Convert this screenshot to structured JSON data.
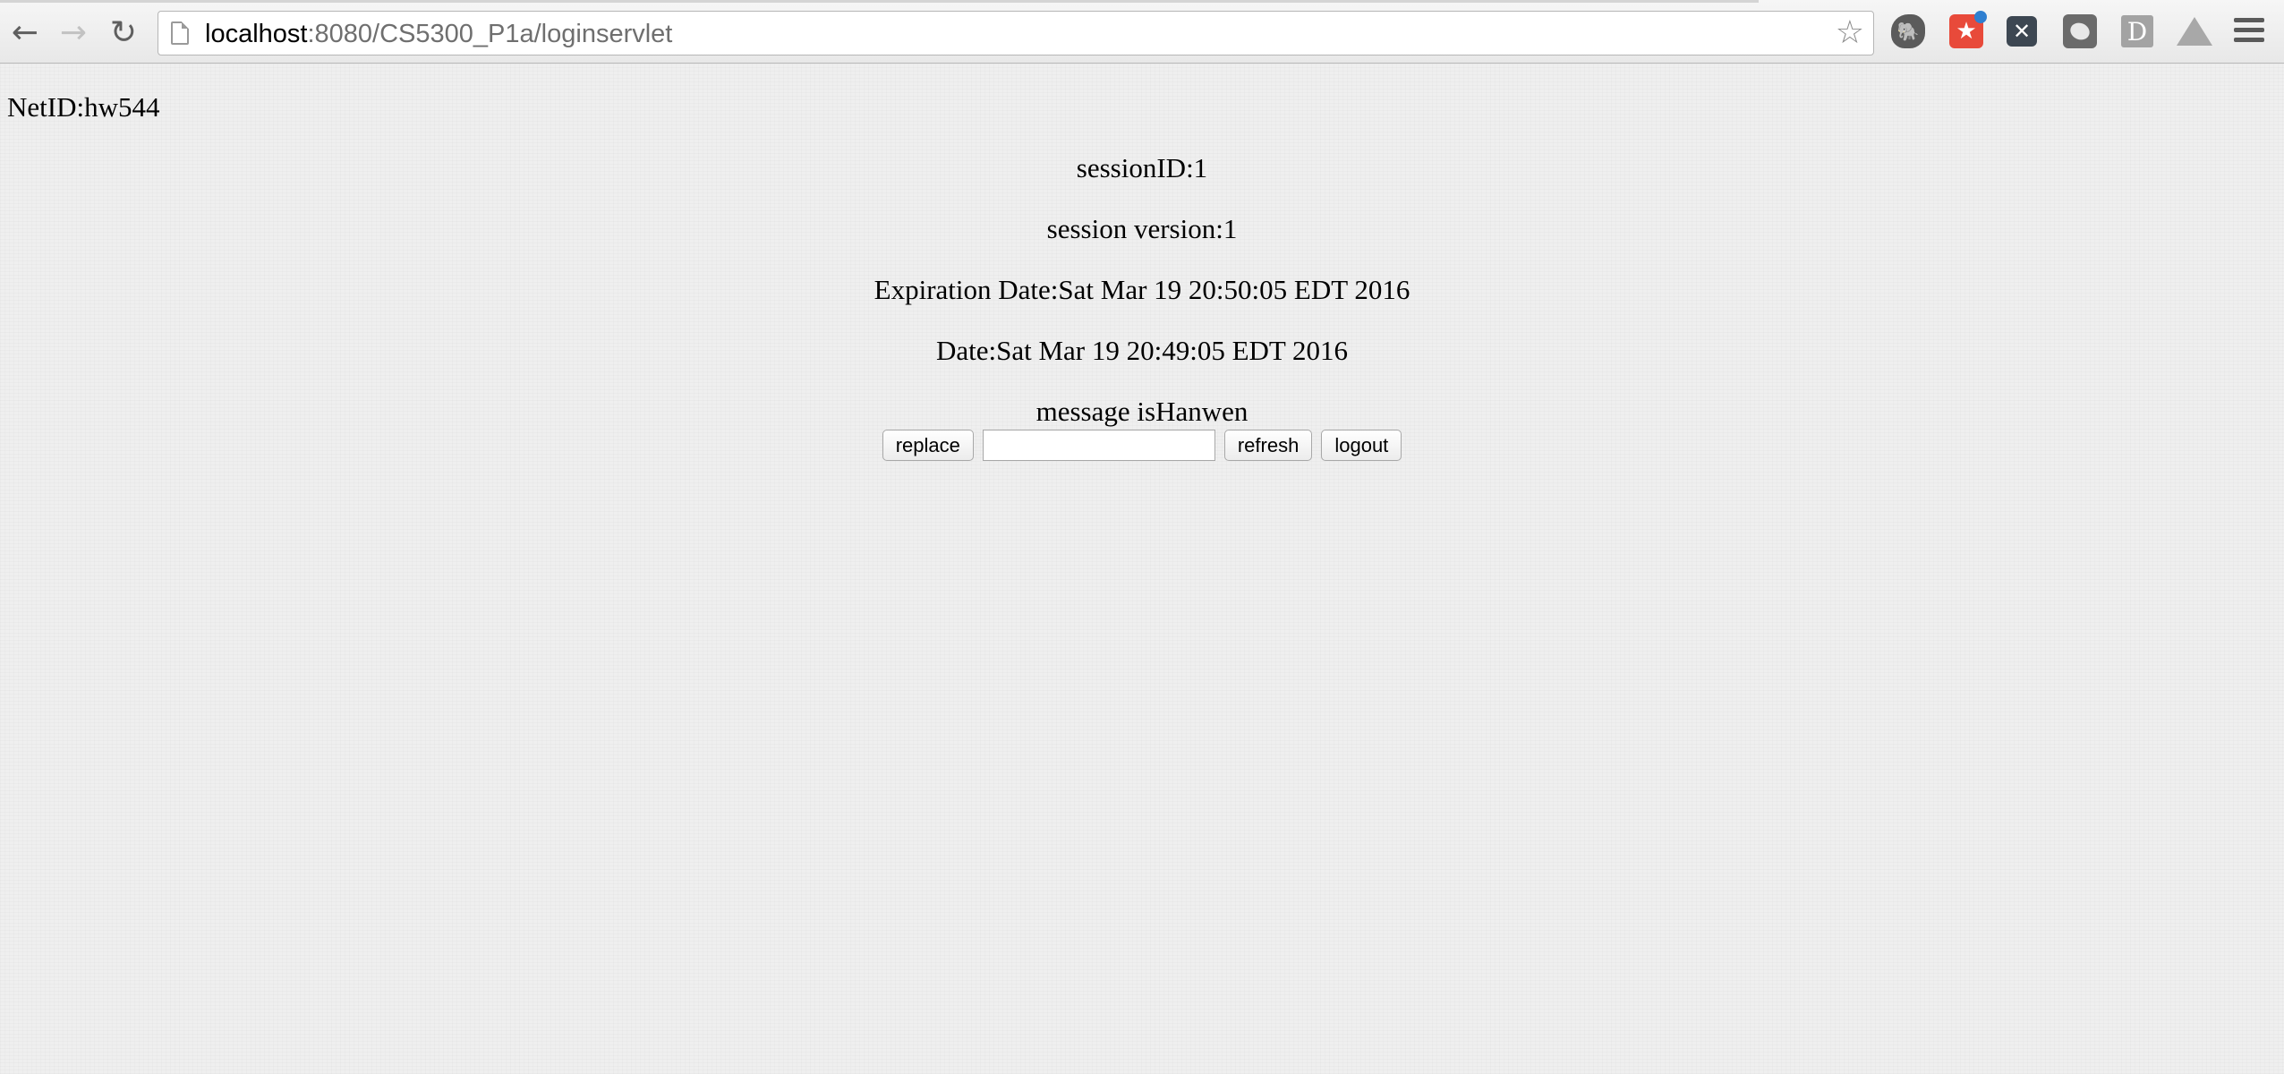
{
  "browser": {
    "url_host": "localhost",
    "url_rest": ":8080/CS5300_P1a/loginservlet",
    "icons": {
      "back": "back-arrow-icon",
      "forward": "forward-arrow-icon",
      "reload": "reload-icon",
      "page": "page-icon",
      "bookmark": "star-icon",
      "extensions": [
        "evernote-icon",
        "pocket-icon",
        "x-extension-icon",
        "shield-extension-icon",
        "d-extension-icon",
        "drive-icon"
      ],
      "menu": "hamburger-menu-icon"
    },
    "ext_d_label": "D",
    "ext_x_label": "✕"
  },
  "page": {
    "netid": "NetID:hw544",
    "session_id": "sessionID:1",
    "session_version": "session version:1",
    "expiration": "Expiration Date:Sat Mar 19 20:50:05 EDT 2016",
    "date": "Date:Sat Mar 19 20:49:05 EDT 2016",
    "message": "message isHanwen"
  },
  "form": {
    "replace_label": "replace",
    "input_value": "",
    "refresh_label": "refresh",
    "logout_label": "logout"
  }
}
